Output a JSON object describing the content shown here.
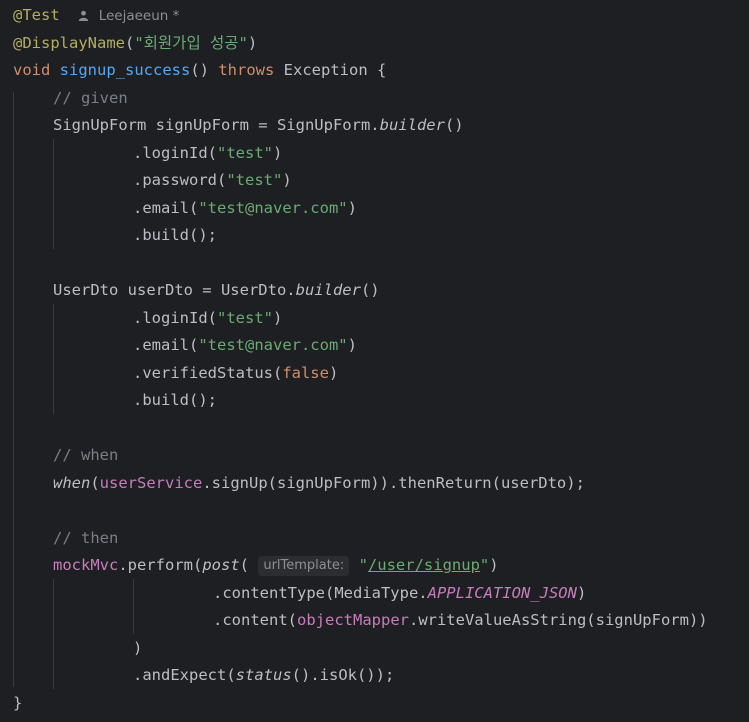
{
  "author": {
    "name": "Leejaeeun *",
    "icon": "person-icon"
  },
  "code": {
    "l1": "@Test",
    "l2_anno": "@DisplayName",
    "l2_open": "(",
    "l2_str": "\"회원가입 성공\"",
    "l2_close": ")",
    "l3_void": "void",
    "l3_name": "signup_success",
    "l3_paren": "() ",
    "l3_throws": "throws",
    "l3_rest": " Exception {",
    "l4": "// given",
    "l5_a": "SignUpForm signUpForm = SignUpForm.",
    "l5_b": "builder",
    "l5_c": "()",
    "l6_a": ".loginId(",
    "l6_s": "\"test\"",
    "l6_c": ")",
    "l7_a": ".password(",
    "l7_s": "\"test\"",
    "l7_c": ")",
    "l8_a": ".email(",
    "l8_s": "\"test@naver.com\"",
    "l8_c": ")",
    "l9": ".build();",
    "l11_a": "UserDto userDto = UserDto.",
    "l11_b": "builder",
    "l11_c": "()",
    "l12_a": ".loginId(",
    "l12_s": "\"test\"",
    "l12_c": ")",
    "l13_a": ".email(",
    "l13_s": "\"test@naver.com\"",
    "l13_c": ")",
    "l14_a": ".verifiedStatus(",
    "l14_s": "false",
    "l14_c": ")",
    "l15": ".build();",
    "l17": "// when",
    "l18_a": "when",
    "l18_b": "(",
    "l18_c": "userService",
    "l18_d": ".signUp(signUpForm)).thenReturn(userDto);",
    "l20": "// then",
    "l21_a": "mockMvc",
    "l21_b": ".perform(",
    "l21_c": "post",
    "l21_d": "( ",
    "l21_hint": "urlTemplate:",
    "l21_s1": "\"",
    "l21_s2": "/user/signup",
    "l21_s3": "\"",
    "l21_e": ")",
    "l22_a": ".contentType(MediaType.",
    "l22_b": "APPLICATION_JSON",
    "l22_c": ")",
    "l23_a": ".content(",
    "l23_b": "objectMapper",
    "l23_c": ".writeValueAsString(signUpForm))",
    "l24": ")",
    "l25_a": ".andExpect(",
    "l25_b": "status",
    "l25_c": "().isOk());",
    "l26": "}"
  },
  "colors": {
    "background": "#1e1f22",
    "keyword": "#cf8e6d",
    "annotation": "#b3ae60",
    "string": "#6aab73",
    "comment": "#7a7e85",
    "method": "#56a8f5",
    "field": "#c77dbb"
  }
}
